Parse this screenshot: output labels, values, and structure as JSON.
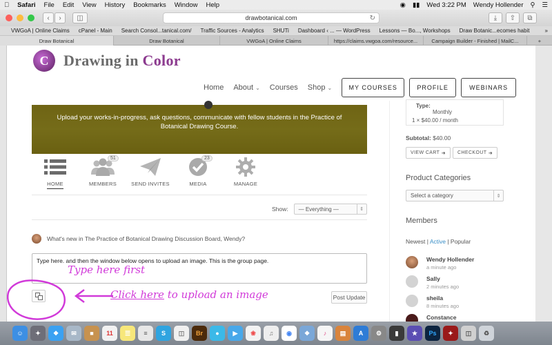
{
  "menubar": {
    "apple": "",
    "app": "Safari",
    "items": [
      "File",
      "Edit",
      "View",
      "History",
      "Bookmarks",
      "Window",
      "Help"
    ],
    "clock": "Wed 3:22 PM",
    "user": "Wendy Hollender"
  },
  "browser": {
    "url": "drawbotanical.com",
    "bookmarks": [
      "VWGoA | Online Claims",
      "cPanel - Main",
      "Search Consol...tanical.com/",
      "Traffic Sources - Analytics",
      "SHUTi",
      "Dashboard ‹ ... — WordPress",
      "Lessons — Bo..., Workshops",
      "Draw Botanic...ecomes habit"
    ],
    "tabs": [
      "Draw Botanical",
      "Draw Botanical",
      "VWGoA | Online Claims",
      "https://claims.vwgoa.com/resource...",
      "Campaign Builder - Finished | MailC..."
    ]
  },
  "site": {
    "logo_mark": "C",
    "logo_text_a": "Drawing in ",
    "logo_text_b": "Color",
    "nav": {
      "home": "Home",
      "about": "About",
      "courses": "Courses",
      "shop": "Shop",
      "my_courses": "MY COURSES",
      "profile": "PROFILE",
      "webinars": "WEBINARS"
    },
    "banner_text": "Upload your works-in-progress, ask questions, communicate with fellow students in the Practice of Botanical Drawing Course.",
    "group_nav": [
      {
        "label": "HOME",
        "badge": ""
      },
      {
        "label": "MEMBERS",
        "badge": "51"
      },
      {
        "label": "SEND INVITES",
        "badge": ""
      },
      {
        "label": "MEDIA",
        "badge": "23"
      },
      {
        "label": "MANAGE",
        "badge": ""
      }
    ],
    "show_label": "Show:",
    "show_value": "— Everything —",
    "whats_new": "What's new in The Practice of Botanical Drawing Discussion Board, Wendy?",
    "post_text": "Type here. and then the window below opens to upload an image. This is the group page.",
    "post_button": "Post Update",
    "annotation_first": "Type here first",
    "annotation_click": "Click here",
    "annotation_rest": " to upload an image"
  },
  "sidebar": {
    "cart_type_label": "Type:",
    "cart_type_value": "Monthly",
    "cart_price": "1 × $40.00 / month",
    "subtotal_label": "Subtotal:",
    "subtotal_value": "$40.00",
    "view_cart": "VIEW CART",
    "checkout": "CHECKOUT",
    "categories_title": "Product Categories",
    "category_placeholder": "Select a category",
    "members_title": "Members",
    "filter_newest": "Newest",
    "filter_active": "Active",
    "filter_popular": "Popular",
    "members": [
      {
        "name": "Wendy Hollender",
        "time": "a minute ago"
      },
      {
        "name": "Sally",
        "time": "2 minutes ago"
      },
      {
        "name": "sheila",
        "time": "8 minutes ago"
      },
      {
        "name": "Constance",
        "time": ""
      }
    ]
  },
  "dock": {
    "br": "Br",
    "ps": "Ps",
    "ai": "S",
    "calendar": "11"
  },
  "colors": {
    "banner": "#756c19",
    "accent": "#8c3b8f",
    "annotation": "#d13ad9",
    "link": "#3a8fc7"
  }
}
